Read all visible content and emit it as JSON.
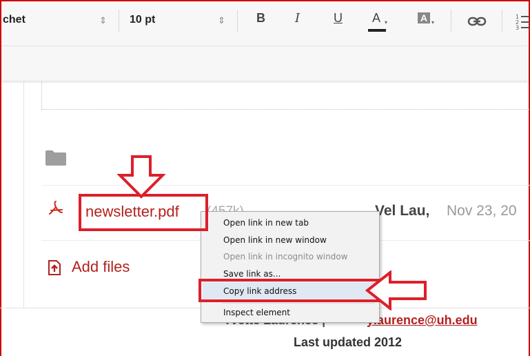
{
  "toolbar": {
    "font_name": "chet",
    "font_size": "10 pt",
    "spinner": "⇕",
    "bold": "B",
    "italic": "I",
    "underline": "U",
    "text_color": "A",
    "highlight": "A",
    "dropdown": "▾"
  },
  "file": {
    "name": "newsletter.pdf",
    "size": "(457k)",
    "owner": "Vel Lau,",
    "date": "Nov 23, 20"
  },
  "add_files": "Add files",
  "context_menu": {
    "items": [
      {
        "label": "Open link in new tab",
        "enabled": true
      },
      {
        "label": "Open link in new window",
        "enabled": true
      },
      {
        "label": "Open link in incognito window",
        "enabled": false
      },
      {
        "label": "Save link as...",
        "enabled": true
      },
      {
        "label": "Copy link address",
        "enabled": true,
        "highlighted": true
      },
      {
        "label": "Inspect element",
        "enabled": true
      }
    ]
  },
  "footer": {
    "author": "Yvette Laurence |",
    "email": "ylaurence@uh.edu",
    "updated": "Last updated 2012"
  },
  "colors": {
    "annotation_red": "#dd1f2a",
    "link_red": "#b3211e"
  }
}
